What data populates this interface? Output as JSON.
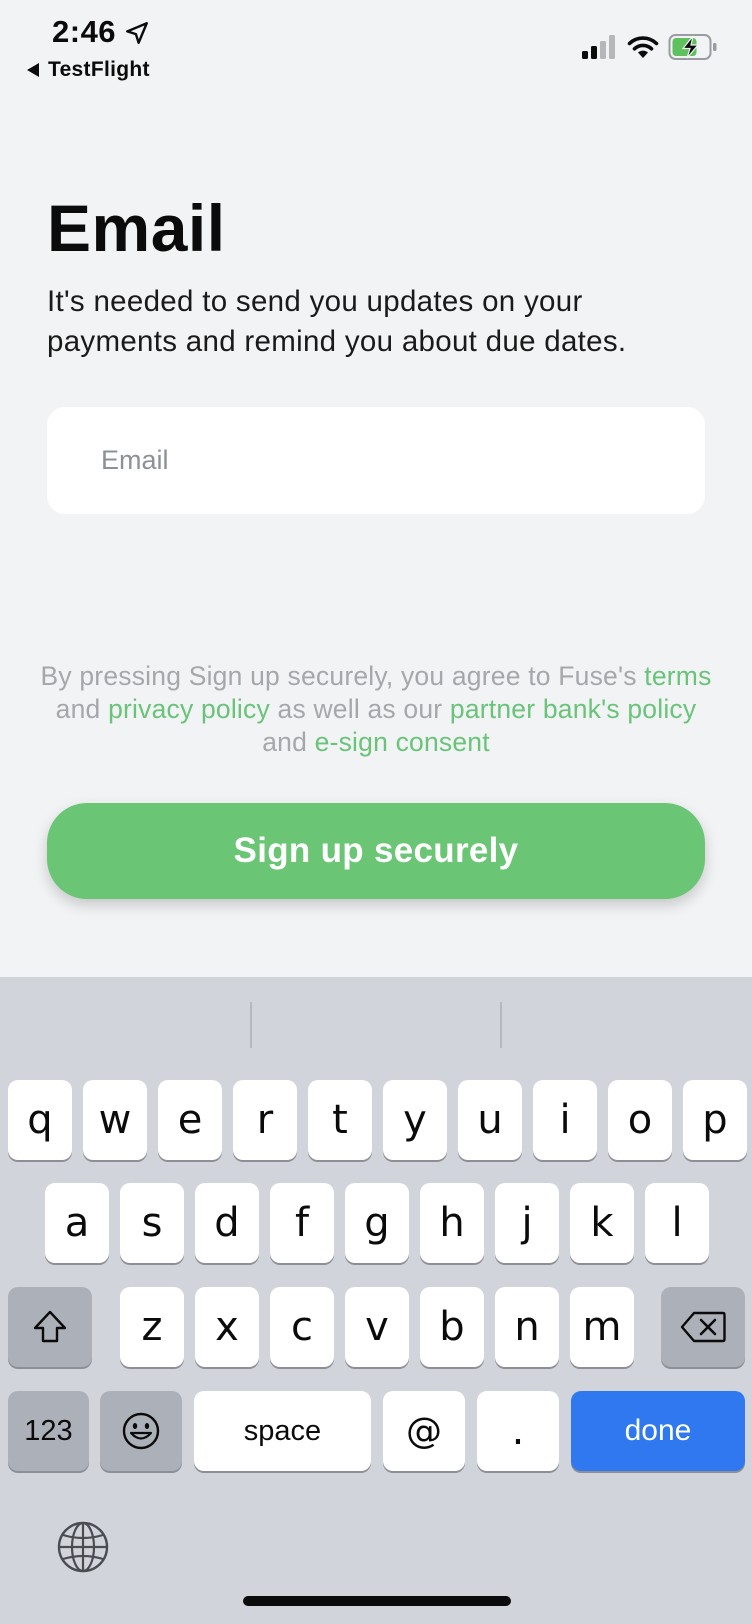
{
  "status_bar": {
    "time": "2:46",
    "back_app": "TestFlight",
    "icons": [
      "location-arrow-icon",
      "cellular-signal-icon",
      "wifi-icon",
      "battery-charging-icon"
    ]
  },
  "page": {
    "title": "Email",
    "subtitle": "It's needed to send you updates on your payments and remind you about due dates."
  },
  "email_field": {
    "placeholder": "Email",
    "value": ""
  },
  "legal": {
    "prefix": "By pressing Sign up securely, you agree to Fuse's",
    "terms": "terms",
    "and_1": "and",
    "privacy": "privacy policy",
    "middle": "as well as our",
    "partner": "partner bank's policy",
    "and_2": "and",
    "esign": "e-sign consent"
  },
  "signup_button": {
    "label": "Sign up securely"
  },
  "keyboard": {
    "row1": [
      "q",
      "w",
      "e",
      "r",
      "t",
      "y",
      "u",
      "i",
      "o",
      "p"
    ],
    "row2": [
      "a",
      "s",
      "d",
      "f",
      "g",
      "h",
      "j",
      "k",
      "l"
    ],
    "row3": [
      "z",
      "x",
      "c",
      "v",
      "b",
      "n",
      "m"
    ],
    "numbers": "123",
    "space": "space",
    "at": "@",
    "dot": ".",
    "done": "done"
  },
  "colors": {
    "accent": "#6ac575",
    "link": "#69c479",
    "done_key": "#2f78f0",
    "background": "#f2f3f5",
    "keyboard": "#d1d4da"
  }
}
